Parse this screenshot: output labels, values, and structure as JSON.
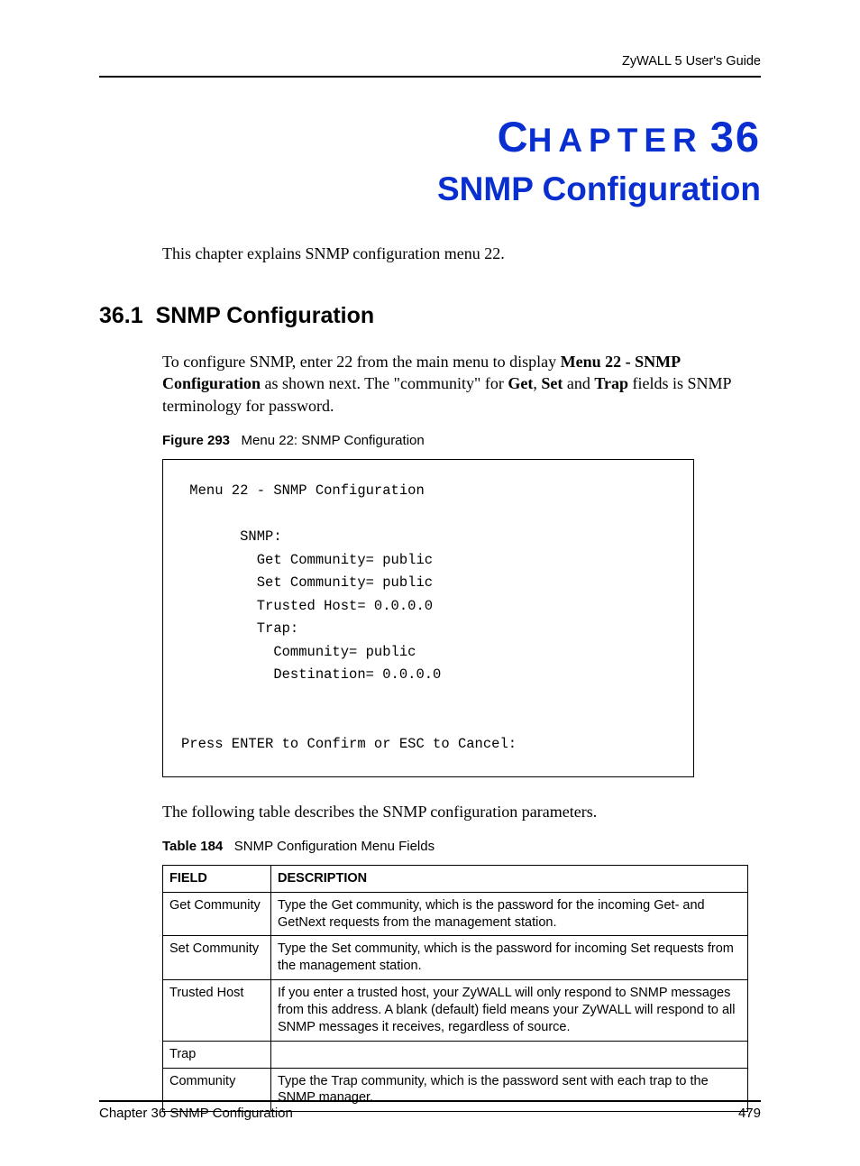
{
  "running_head": "ZyWALL 5 User's Guide",
  "chapter": {
    "word_big": "C",
    "word_rest": "HAPTER",
    "number": "36",
    "title": "SNMP Configuration"
  },
  "intro": "This chapter explains SNMP configuration menu 22.",
  "section": {
    "number": "36.1",
    "title": "SNMP Configuration"
  },
  "para1_pre": "To configure SNMP, enter 22 from the main menu to display ",
  "para1_b1": "Menu 22 - SNMP Configuration",
  "para1_mid1": " as shown next. The \"community\" for ",
  "para1_b2": "Get",
  "para1_sep1": ", ",
  "para1_b3": "Set",
  "para1_sep2": " and ",
  "para1_b4": "Trap",
  "para1_post": " fields is SNMP terminology for password.",
  "figure": {
    "label": "Figure 293",
    "caption": "Menu 22: SNMP Configuration"
  },
  "terminal": " Menu 22 - SNMP Configuration\n\n       SNMP:\n         Get Community= public\n         Set Community= public\n         Trusted Host= 0.0.0.0\n         Trap:\n           Community= public\n           Destination= 0.0.0.0\n\n\nPress ENTER to Confirm or ESC to Cancel:",
  "para2": "The following table describes the SNMP configuration parameters.",
  "table": {
    "label": "Table 184",
    "caption": "SNMP Configuration Menu Fields",
    "head_field": "FIELD",
    "head_desc": "DESCRIPTION",
    "rows": [
      {
        "field": "Get Community",
        "desc": "Type the Get community, which is the password for the incoming Get- and GetNext requests from the management station."
      },
      {
        "field": "Set Community",
        "desc": "Type the Set community, which is the password for incoming Set requests from the management station."
      },
      {
        "field": "Trusted Host",
        "desc": "If you enter a trusted host, your ZyWALL will only respond to SNMP messages from this address. A blank (default) field means your ZyWALL will respond to all SNMP messages it receives, regardless of source."
      },
      {
        "field": "Trap",
        "desc": ""
      },
      {
        "field": "Community",
        "desc": "Type the Trap community, which is the password sent with each trap to the SNMP manager."
      }
    ]
  },
  "footer": {
    "left": "Chapter 36 SNMP Configuration",
    "right": "479"
  }
}
